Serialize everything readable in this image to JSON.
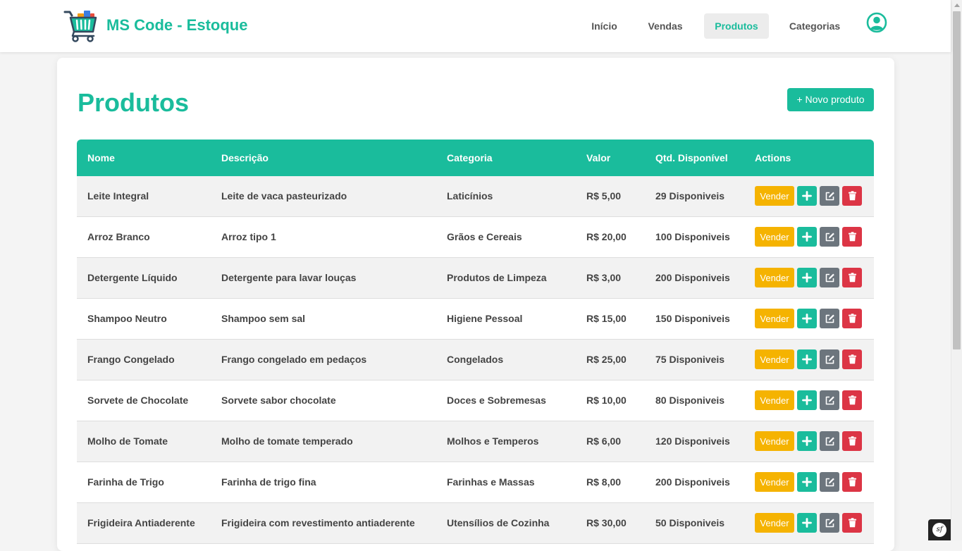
{
  "brand": {
    "name": "MS Code - Estoque",
    "logo_icon": "shopping-cart-icon",
    "color": "#1abc9c"
  },
  "nav": {
    "items": [
      {
        "label": "Início"
      },
      {
        "label": "Vendas"
      },
      {
        "label": "Produtos",
        "active": true
      },
      {
        "label": "Categorias"
      }
    ],
    "user_icon": "user-circle-icon"
  },
  "page": {
    "title": "Produtos",
    "new_button": "+ Novo produto"
  },
  "table": {
    "headers": {
      "nome": "Nome",
      "descricao": "Descrição",
      "categoria": "Categoria",
      "valor": "Valor",
      "qtd": "Qtd. Disponível",
      "actions": "Actions"
    },
    "rows": [
      {
        "nome": "Leite Integral",
        "descricao": "Leite de vaca pasteurizado",
        "categoria": "Laticínios",
        "valor": "R$ 5,00",
        "qtd": "29 Disponiveis"
      },
      {
        "nome": "Arroz Branco",
        "descricao": "Arroz tipo 1",
        "categoria": "Grãos e Cereais",
        "valor": "R$ 20,00",
        "qtd": "100 Disponiveis"
      },
      {
        "nome": "Detergente Líquido",
        "descricao": "Detergente para lavar louças",
        "categoria": "Produtos de Limpeza",
        "valor": "R$ 3,00",
        "qtd": "200 Disponiveis"
      },
      {
        "nome": "Shampoo Neutro",
        "descricao": "Shampoo sem sal",
        "categoria": "Higiene Pessoal",
        "valor": "R$ 15,00",
        "qtd": "150 Disponiveis"
      },
      {
        "nome": "Frango Congelado",
        "descricao": "Frango congelado em pedaços",
        "categoria": "Congelados",
        "valor": "R$ 25,00",
        "qtd": "75 Disponiveis"
      },
      {
        "nome": "Sorvete de Chocolate",
        "descricao": "Sorvete sabor chocolate",
        "categoria": "Doces e Sobremesas",
        "valor": "R$ 10,00",
        "qtd": "80 Disponiveis"
      },
      {
        "nome": "Molho de Tomate",
        "descricao": "Molho de tomate temperado",
        "categoria": "Molhos e Temperos",
        "valor": "R$ 6,00",
        "qtd": "120 Disponiveis"
      },
      {
        "nome": "Farinha de Trigo",
        "descricao": "Farinha de trigo fina",
        "categoria": "Farinhas e Massas",
        "valor": "R$ 8,00",
        "qtd": "200 Disponiveis"
      },
      {
        "nome": "Frigideira Antiaderente",
        "descricao": "Frigideira com revestimento antiaderente",
        "categoria": "Utensílios de Cozinha",
        "valor": "R$ 30,00",
        "qtd": "50 Disponiveis"
      }
    ],
    "row_actions": {
      "sell_label": "Vender",
      "add_icon": "plus-icon",
      "edit_icon": "edit-icon",
      "delete_icon": "trash-icon"
    }
  },
  "colors": {
    "primary": "#1abc9c",
    "sell": "#f5b301",
    "edit": "#6c757d",
    "delete": "#dc3545"
  },
  "debug_toolbar": {
    "icon": "symfony-icon",
    "label": "sf"
  }
}
